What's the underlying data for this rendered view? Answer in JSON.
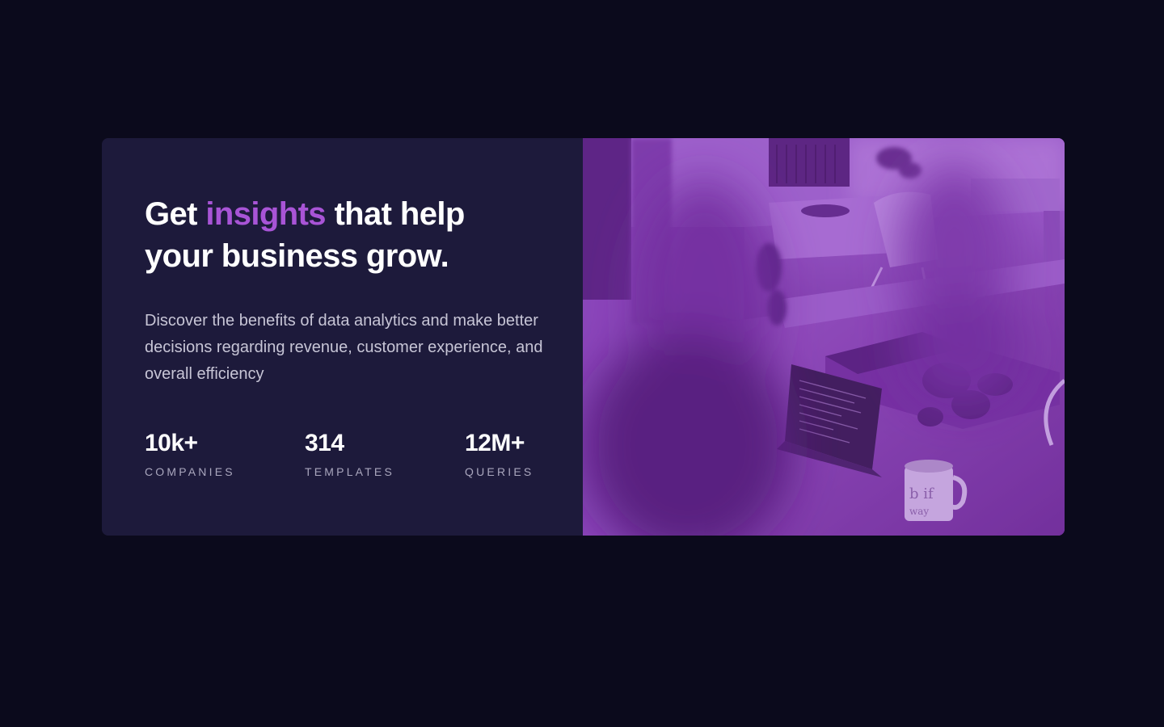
{
  "hero": {
    "headline_part1": "Get ",
    "headline_accent": "insights",
    "headline_part2": " that help your business grow.",
    "description": "Discover the benefits of data analytics and make better decisions regarding revenue, customer experience, and overall efficiency",
    "stats": [
      {
        "value": "10k+",
        "label": "COMPANIES"
      },
      {
        "value": "314",
        "label": "TEMPLATES"
      },
      {
        "value": "12M+",
        "label": "QUERIES"
      }
    ],
    "image": {
      "description": "Office workspace with laptop, plants and mug, purple color overlay",
      "mug_text": "b if / way"
    }
  },
  "colors": {
    "page_background": "#0b0a1c",
    "card_background": "#1d1a3b",
    "accent": "#a854d6",
    "overlay": "#8d3fbf"
  }
}
